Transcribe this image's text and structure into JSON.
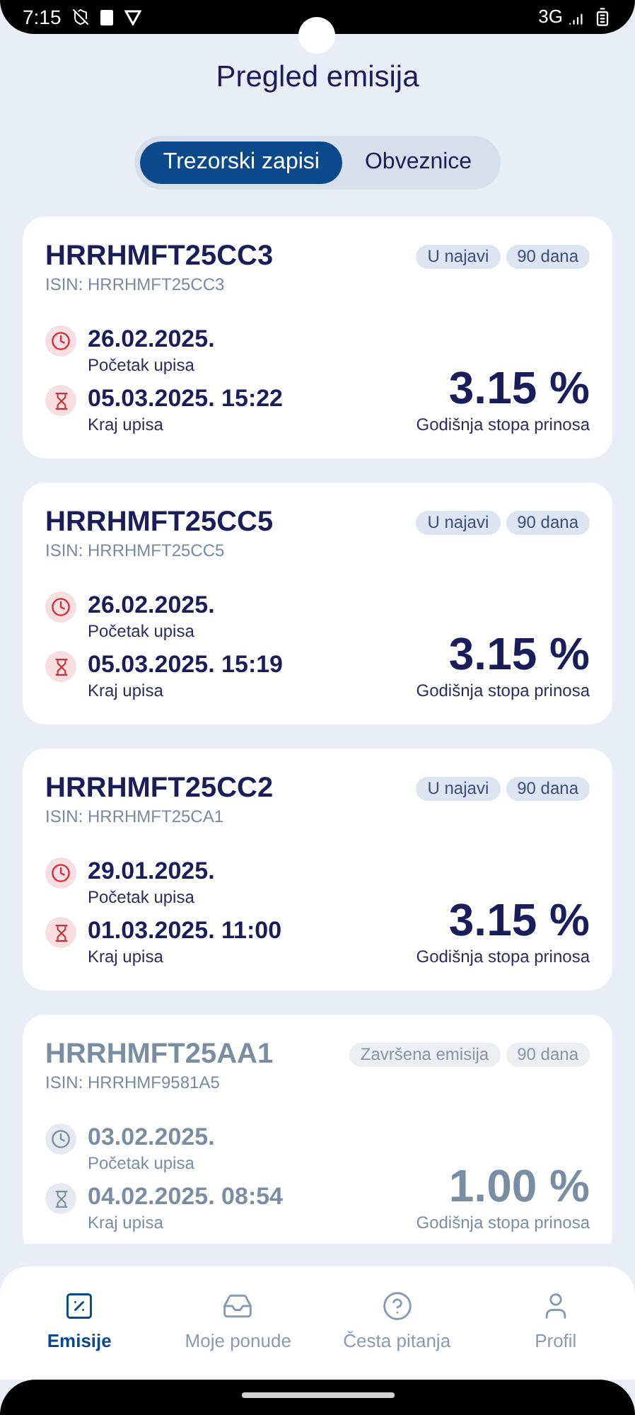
{
  "status_bar": {
    "time": "7:15",
    "network": "3G"
  },
  "title": "Pregled emisija",
  "tabs": [
    {
      "label": "Trezorski zapisi",
      "selected": true
    },
    {
      "label": "Obveznice",
      "selected": false
    }
  ],
  "issues": [
    {
      "code": "HRRHMFT25CC3",
      "isin": "ISIN: HRRHMFT25CC3",
      "finished": false,
      "badges": [
        "U najavi",
        "90 dana"
      ],
      "start_date": "26.02.2025.",
      "start_label": "Početak upisa",
      "end_date": "05.03.2025. 15:22",
      "end_label": "Kraj upisa",
      "rate": "3.15 %",
      "rate_label": "Godišnja stopa prinosa"
    },
    {
      "code": "HRRHMFT25CC5",
      "isin": "ISIN: HRRHMFT25CC5",
      "finished": false,
      "badges": [
        "U najavi",
        "90 dana"
      ],
      "start_date": "26.02.2025.",
      "start_label": "Početak upisa",
      "end_date": "05.03.2025. 15:19",
      "end_label": "Kraj upisa",
      "rate": "3.15 %",
      "rate_label": "Godišnja stopa prinosa"
    },
    {
      "code": "HRRHMFT25CC2",
      "isin": "ISIN: HRRHMFT25CA1",
      "finished": false,
      "badges": [
        "U najavi",
        "90 dana"
      ],
      "start_date": "29.01.2025.",
      "start_label": "Početak upisa",
      "end_date": "01.03.2025. 11:00",
      "end_label": "Kraj upisa",
      "rate": "3.15 %",
      "rate_label": "Godišnja stopa prinosa"
    },
    {
      "code": "HRRHMFT25AA1",
      "isin": "ISIN: HRRHMF9581A5",
      "finished": true,
      "badges": [
        "Završena emisija",
        "90 dana"
      ],
      "start_date": "03.02.2025.",
      "start_label": "Početak upisa",
      "end_date": "04.02.2025. 08:54",
      "end_label": "Kraj upisa",
      "rate": "1.00 %",
      "rate_label": "Godišnja stopa prinosa"
    }
  ],
  "nav": [
    {
      "kind": "issues",
      "label": "Emisije",
      "selected": true
    },
    {
      "kind": "offers",
      "label": "Moje ponude",
      "selected": false
    },
    {
      "kind": "faq",
      "label": "Česta pitanja",
      "selected": false
    },
    {
      "kind": "profile",
      "label": "Profil",
      "selected": false
    }
  ]
}
